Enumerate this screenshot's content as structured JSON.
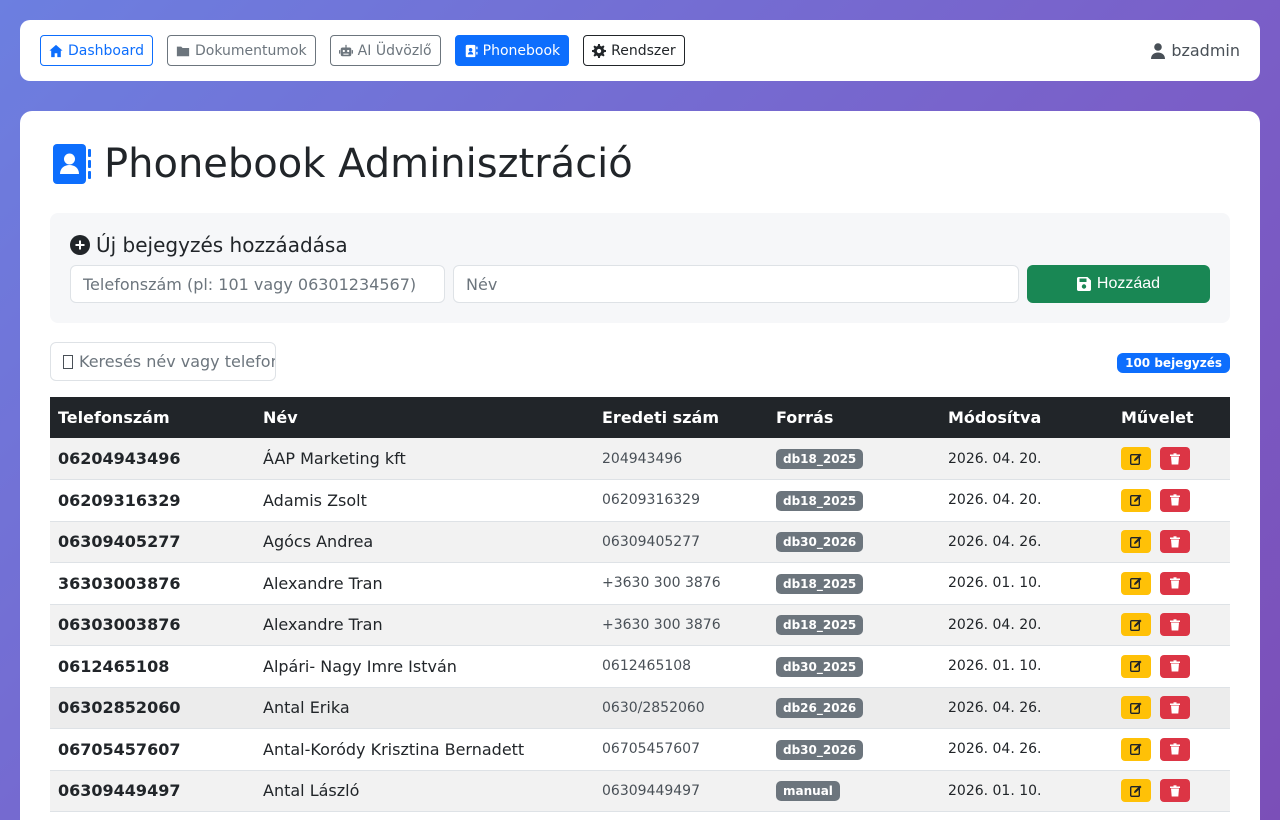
{
  "nav": {
    "items": [
      {
        "label": "Dashboard",
        "icon": "home-icon"
      },
      {
        "label": "Dokumentumok",
        "icon": "folder-icon"
      },
      {
        "label": "AI Üdvözlő",
        "icon": "robot-icon"
      },
      {
        "label": "Phonebook",
        "icon": "contact-book-icon"
      },
      {
        "label": "Rendszer",
        "icon": "gear-icon"
      }
    ],
    "user": "bzadmin"
  },
  "page": {
    "title": "Phonebook Adminisztráció"
  },
  "add": {
    "heading": "Új bejegyzés hozzáadása",
    "phone_placeholder": "Telefonszám (pl: 101 vagy 06301234567)",
    "name_placeholder": "Név",
    "button": "Hozzáad"
  },
  "search": {
    "placeholder": "Keresés név vagy telefonszám alapján"
  },
  "count_badge": "100 bejegyzés",
  "table": {
    "headers": [
      "Telefonszám",
      "Név",
      "Eredeti szám",
      "Forrás",
      "Módosítva",
      "Művelet"
    ],
    "rows": [
      {
        "phone": "06204943496",
        "name": "ÁAP Marketing kft",
        "orig": "204943496",
        "source": "db18_2025",
        "modified": "2026. 04. 20."
      },
      {
        "phone": "06209316329",
        "name": "Adamis Zsolt",
        "orig": "06209316329",
        "source": "db18_2025",
        "modified": "2026. 04. 20."
      },
      {
        "phone": "06309405277",
        "name": "Agócs Andrea",
        "orig": "06309405277",
        "source": "db30_2026",
        "modified": "2026. 04. 26."
      },
      {
        "phone": "36303003876",
        "name": "Alexandre Tran",
        "orig": "+3630 300 3876",
        "source": "db18_2025",
        "modified": "2026. 01. 10."
      },
      {
        "phone": "06303003876",
        "name": "Alexandre Tran",
        "orig": "+3630 300 3876",
        "source": "db18_2025",
        "modified": "2026. 04. 20."
      },
      {
        "phone": "0612465108",
        "name": "Alpári- Nagy Imre István",
        "orig": "0612465108",
        "source": "db30_2025",
        "modified": "2026. 01. 10."
      },
      {
        "phone": "06302852060",
        "name": "Antal Erika",
        "orig": "0630/2852060",
        "source": "db26_2026",
        "modified": "2026. 04. 26."
      },
      {
        "phone": "06705457607",
        "name": "Antal-Koródy Krisztina Bernadett",
        "orig": "06705457607",
        "source": "db30_2026",
        "modified": "2026. 04. 26."
      },
      {
        "phone": "06309449497",
        "name": "Antal László",
        "orig": "06309449497",
        "source": "manual",
        "modified": "2026. 01. 10."
      }
    ]
  }
}
